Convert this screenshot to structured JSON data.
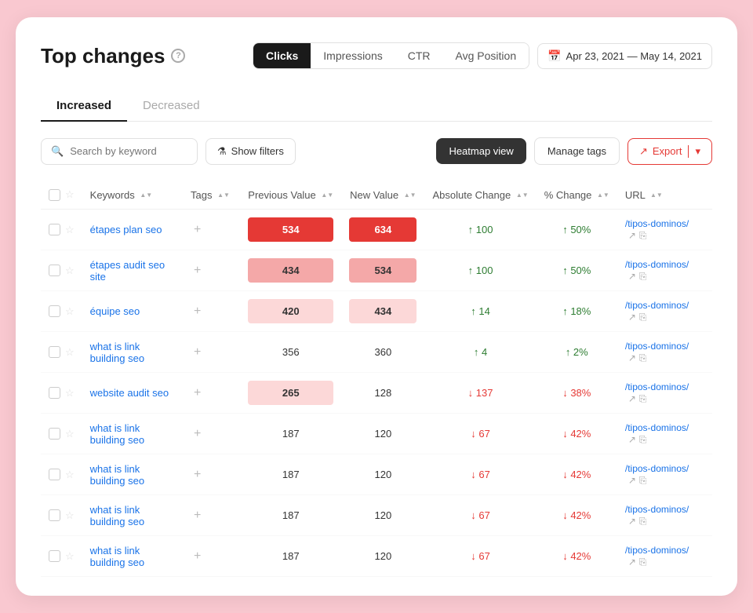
{
  "page": {
    "title": "Top changes",
    "help_title": "?"
  },
  "metric_tabs": [
    {
      "label": "Clicks",
      "active": true
    },
    {
      "label": "Impressions",
      "active": false
    },
    {
      "label": "CTR",
      "active": false
    },
    {
      "label": "Avg Position",
      "active": false
    }
  ],
  "date_range": "Apr 23, 2021 — May 14, 2021",
  "change_tabs": [
    {
      "label": "Increased",
      "active": true
    },
    {
      "label": "Decreased",
      "active": false
    }
  ],
  "toolbar": {
    "search_placeholder": "Search by keyword",
    "filter_label": "Show filters",
    "heatmap_label": "Heatmap view",
    "manage_tags_label": "Manage tags",
    "export_label": "Export"
  },
  "table": {
    "columns": [
      {
        "label": "Keywords"
      },
      {
        "label": "Tags"
      },
      {
        "label": "Previous Value"
      },
      {
        "label": "New Value"
      },
      {
        "label": "Absolute Change"
      },
      {
        "label": "% Change"
      },
      {
        "label": "URL"
      }
    ],
    "rows": [
      {
        "keyword": "étapes plan seo",
        "prev_value": "534",
        "new_value": "634",
        "absolute_change": "↑ 100",
        "pct_change": "↑ 50%",
        "url": "/tipos-dominos/",
        "prev_heat": "dark",
        "new_heat": "dark",
        "change_dir": "positive"
      },
      {
        "keyword": "étapes audit seo site",
        "prev_value": "434",
        "new_value": "534",
        "absolute_change": "↑ 100",
        "pct_change": "↑ 50%",
        "url": "/tipos-dominos/",
        "prev_heat": "mid",
        "new_heat": "mid",
        "change_dir": "positive"
      },
      {
        "keyword": "équipe seo",
        "prev_value": "420",
        "new_value": "434",
        "absolute_change": "↑ 14",
        "pct_change": "↑ 18%",
        "url": "/tipos-dominos/",
        "prev_heat": "light",
        "new_heat": "light",
        "change_dir": "positive"
      },
      {
        "keyword": "what is link building seo",
        "prev_value": "356",
        "new_value": "360",
        "absolute_change": "↑ 4",
        "pct_change": "↑ 2%",
        "url": "/tipos-dominos/",
        "prev_heat": "none",
        "new_heat": "none",
        "change_dir": "positive"
      },
      {
        "keyword": "website audit seo",
        "prev_value": "265",
        "new_value": "128",
        "absolute_change": "↓ 137",
        "pct_change": "↓ 38%",
        "url": "/tipos-dominos/",
        "prev_heat": "light",
        "new_heat": "none",
        "change_dir": "negative"
      },
      {
        "keyword": "what is link building seo",
        "prev_value": "187",
        "new_value": "120",
        "absolute_change": "↓ 67",
        "pct_change": "↓ 42%",
        "url": "/tipos-dominos/",
        "prev_heat": "none",
        "new_heat": "none",
        "change_dir": "negative"
      },
      {
        "keyword": "what is link building seo",
        "prev_value": "187",
        "new_value": "120",
        "absolute_change": "↓ 67",
        "pct_change": "↓ 42%",
        "url": "/tipos-dominos/",
        "prev_heat": "none",
        "new_heat": "none",
        "change_dir": "negative"
      },
      {
        "keyword": "what is link building seo",
        "prev_value": "187",
        "new_value": "120",
        "absolute_change": "↓ 67",
        "pct_change": "↓ 42%",
        "url": "/tipos-dominos/",
        "prev_heat": "none",
        "new_heat": "none",
        "change_dir": "negative"
      },
      {
        "keyword": "what is link building seo",
        "prev_value": "187",
        "new_value": "120",
        "absolute_change": "↓ 67",
        "pct_change": "↓ 42%",
        "url": "/tipos-dominos/",
        "prev_heat": "none",
        "new_heat": "none",
        "change_dir": "negative"
      }
    ]
  }
}
